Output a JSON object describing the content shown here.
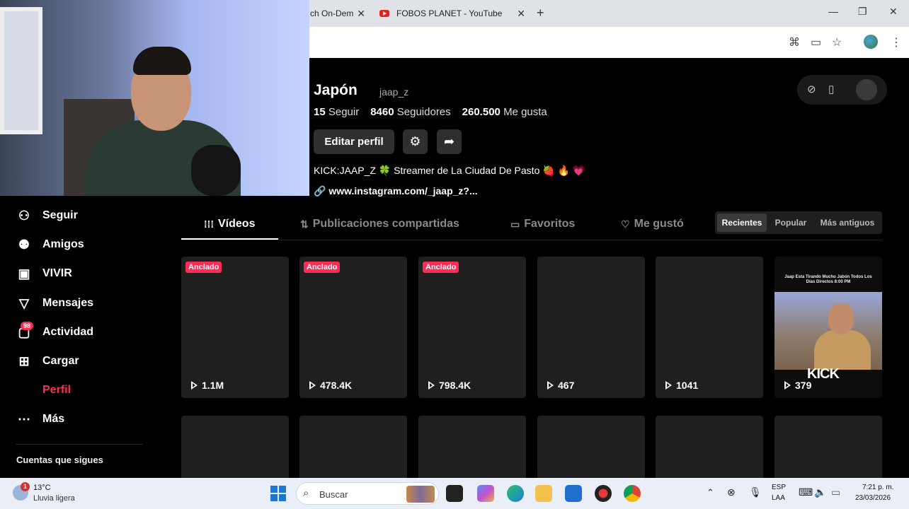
{
  "browser": {
    "tabs": [
      {
        "label": "ch On-Dem"
      },
      {
        "label": "FOBOS PLANET - YouTube"
      }
    ],
    "new_tab_label": "+",
    "window_controls": {
      "minimize": "—",
      "maximize": "❐",
      "close": "✕"
    }
  },
  "sidebar": {
    "items": [
      {
        "label": "Seguir",
        "icon": "follow-icon"
      },
      {
        "label": "Amigos",
        "icon": "friends-icon"
      },
      {
        "label": "VIVIR",
        "icon": "live-icon"
      },
      {
        "label": "Mensajes",
        "icon": "messages-icon"
      },
      {
        "label": "Actividad",
        "icon": "activity-icon",
        "badge": "98"
      },
      {
        "label": "Cargar",
        "icon": "upload-icon"
      },
      {
        "label": "Perfil",
        "icon": "profile-icon"
      },
      {
        "label": "Más",
        "icon": "more-icon"
      }
    ],
    "following_section_title": "Cuentas que sigues"
  },
  "profile": {
    "name": "Japón",
    "handle": "jaap_z",
    "stats": {
      "following_count": "15",
      "following_label": "Seguir",
      "followers_count": "8460",
      "followers_label": "Seguidores",
      "likes_count": "260.500",
      "likes_label": "Me gusta"
    },
    "edit_button": "Editar perfil",
    "bio": "KICK:JAAP_Z 🍀 Streamer de La Ciudad De Pasto 🍓 🔥 💗",
    "link": "www.instagram.com/_jaap_z?..."
  },
  "tabs": [
    {
      "label": "Vídeos",
      "active": true
    },
    {
      "label": "Publicaciones compartidas",
      "active": false
    },
    {
      "label": "Favoritos",
      "active": false
    },
    {
      "label": "Me gustó",
      "active": false
    }
  ],
  "sort_options": [
    {
      "label": "Recientes",
      "selected": true
    },
    {
      "label": "Popular",
      "selected": false
    },
    {
      "label": "Más antiguos",
      "selected": false
    }
  ],
  "pinned_label": "Anclado",
  "videos": [
    {
      "views": "1.1M",
      "pinned": true
    },
    {
      "views": "478.4K",
      "pinned": true
    },
    {
      "views": "798.4K",
      "pinned": true
    },
    {
      "views": "467",
      "pinned": false
    },
    {
      "views": "1041",
      "pinned": false
    },
    {
      "views": "379",
      "pinned": false,
      "thumbnail_caption": "Jaap Esta Tirando Mucho Jabón Todos Los Días Directos 8:00 PM",
      "thumbnail_brand": "KICK"
    }
  ],
  "taskbar": {
    "weather_alert": "1",
    "temperature": "13°C",
    "weather": "Lluvia ligera",
    "search_placeholder": "Buscar",
    "language_line1": "ESP",
    "language_line2": "LAA",
    "time": "7:21 p. m.",
    "date": "23/03/2026"
  },
  "colors": {
    "accent": "#fe2c55",
    "background": "#000000",
    "card": "#1f1f1f",
    "taskbar": "#e9eef7"
  }
}
